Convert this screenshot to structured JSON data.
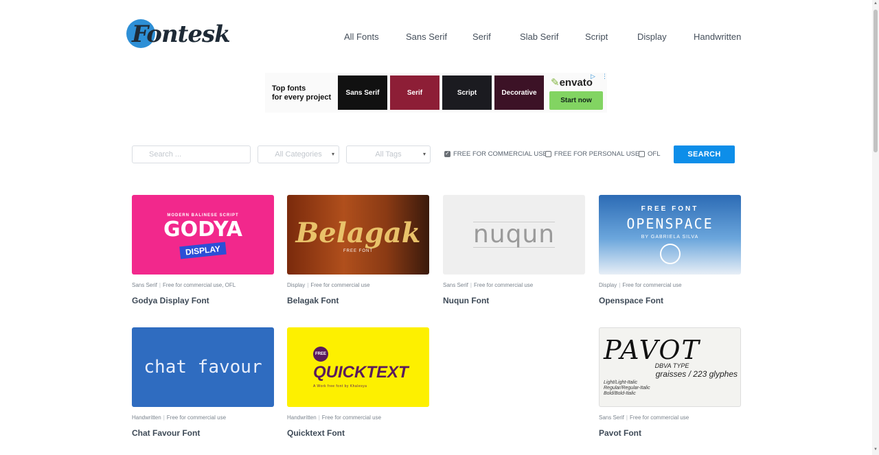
{
  "brand": {
    "logo_text": "Fontesk"
  },
  "nav": [
    {
      "label": "All Fonts"
    },
    {
      "label": "Sans Serif"
    },
    {
      "label": "Serif"
    },
    {
      "label": "Slab Serif"
    },
    {
      "label": "Script"
    },
    {
      "label": "Display"
    },
    {
      "label": "Handwritten"
    }
  ],
  "ad": {
    "headline_line1": "Top fonts",
    "headline_line2": "for every project",
    "tiles": [
      "Sans Serif",
      "Serif",
      "Script",
      "Decorative"
    ],
    "brand": "envato",
    "cta": "Start now",
    "info_icon": "ad-choices-icon",
    "menu_icon": "more-vertical-icon"
  },
  "filters": {
    "search_placeholder": "Search ...",
    "categories": "All Categories",
    "tags": "All Tags",
    "checkboxes": [
      {
        "label": "FREE FOR COMMERCIAL USE",
        "checked": true
      },
      {
        "label": "FREE FOR PERSONAL USE",
        "checked": false
      },
      {
        "label": "OFL",
        "checked": false
      }
    ],
    "search_button": "SEARCH"
  },
  "cards": [
    {
      "title": "Godya Display Font",
      "category": "Sans Serif",
      "license": "Free for commercial use, OFL",
      "thumb_small": "MODERN BALINESE SCRIPT",
      "thumb_main": "GODYA",
      "thumb_tag": "DISPLAY"
    },
    {
      "title": "Belagak Font",
      "category": "Display",
      "license": "Free for commercial use",
      "thumb_main": "Belagak",
      "thumb_sub": "FREE FONT"
    },
    {
      "title": "Nuqun Font",
      "category": "Sans Serif",
      "license": "Free for commercial use",
      "thumb_main": "nuqun"
    },
    {
      "title": "Openspace Font",
      "category": "Display",
      "license": "Free for commercial use",
      "thumb_small": "FREE FONT",
      "thumb_main": "OPENSPACE",
      "thumb_sub": "BY GABRIELA SILVA"
    },
    {
      "title": "Chat Favour Font",
      "category": "Handwritten",
      "license": "Free for commercial use",
      "thumb_main": "chat favour"
    },
    {
      "title": "Quicktext Font",
      "category": "Handwritten",
      "license": "Free for commercial use",
      "thumb_badge": "FREE",
      "thumb_main": "QUICKTEXT",
      "thumb_sub": "A Work free font by Khalesya"
    },
    {
      "title": "Pavot Font",
      "category": "Sans Serif",
      "license": "Free for commercial use",
      "thumb_main": "PAVOT",
      "thumb_sub": "DBVA TYPE",
      "thumb_line": "graisses / 223 glyphes",
      "thumb_styles": "Light/Light-Italic Regular/Regular-Italic Bold/Bold-Italic"
    }
  ],
  "colors": {
    "accent": "#0d8ee9",
    "brand_blue": "#2d8fd6",
    "envato_green": "#82d462"
  }
}
